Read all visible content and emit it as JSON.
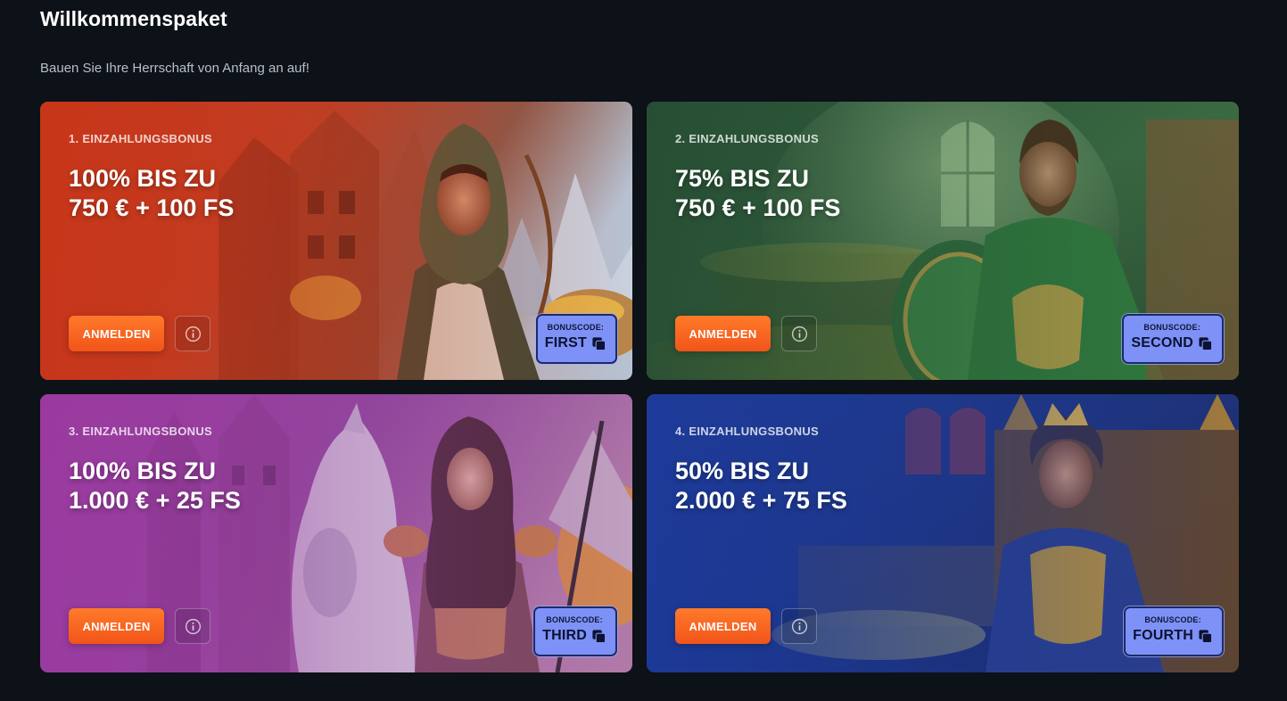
{
  "section": {
    "title": "Willkommenspaket",
    "subtitle": "Bauen Sie Ihre Herrschaft von Anfang an auf!"
  },
  "cards": [
    {
      "eyebrow": "1. EINZAHLUNGSBONUS",
      "offer_line1": "100% BIS ZU",
      "offer_line2": "750 € + 100 FS",
      "button_label": "ANMELDEN",
      "bonus_label": "BONUSCODE:",
      "bonus_code": "FIRST",
      "theme": "red-orange",
      "art": "hooded-archer-with-gold"
    },
    {
      "eyebrow": "2. EINZAHLUNGSBONUS",
      "offer_line1": "75% BIS ZU",
      "offer_line2": "750 € + 100 FS",
      "button_label": "ANMELDEN",
      "bonus_label": "BONUSCODE:",
      "bonus_code": "SECOND",
      "theme": "green",
      "art": "armored-knight-with-shield"
    },
    {
      "eyebrow": "3. EINZAHLUNGSBONUS",
      "offer_line1": "100% BIS ZU",
      "offer_line2": "1.000 € + 25 FS",
      "button_label": "ANMELDEN",
      "bonus_label": "BONUSCODE:",
      "bonus_code": "THIRD",
      "theme": "purple",
      "art": "warrior-woman-with-horse"
    },
    {
      "eyebrow": "4. EINZAHLUNGSBONUS",
      "offer_line1": "50% BIS ZU",
      "offer_line2": "2.000 € + 75 FS",
      "button_label": "ANMELDEN",
      "bonus_label": "BONUSCODE:",
      "bonus_code": "FOURTH",
      "theme": "blue",
      "art": "crowned-king-on-throne"
    }
  ],
  "colors": {
    "page_background": "#0d1118",
    "button_orange": "#f2541a",
    "bonus_code_bg": "#7d91f7"
  },
  "icons": {
    "info": "info-circle-icon",
    "copy": "copy-icon"
  }
}
